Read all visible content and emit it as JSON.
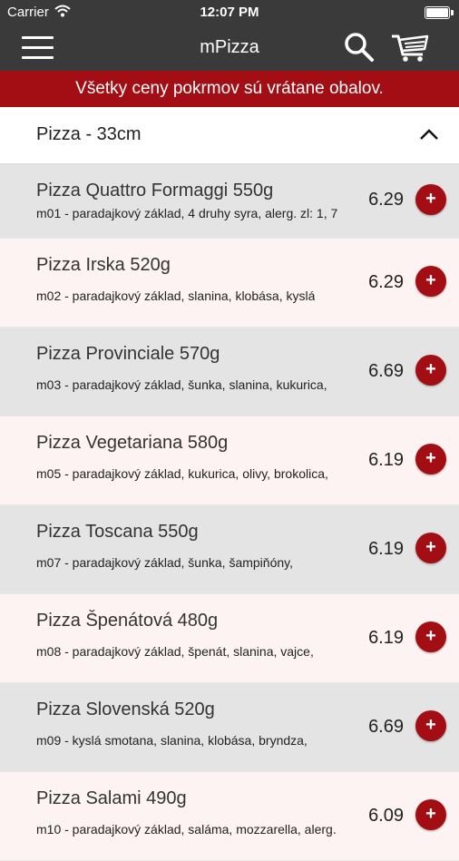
{
  "status": {
    "carrier": "Carrier",
    "time": "12:07 PM"
  },
  "navbar": {
    "title": "mPizza"
  },
  "banner": {
    "text": "Všetky ceny pokrmov sú vrátane obalov."
  },
  "section": {
    "title": "Pizza - 33cm"
  },
  "items": [
    {
      "name": "Pizza Quattro Formaggi 550g",
      "desc": "m01 - paradajkový základ, 4 druhy syra, alerg. zl: 1, 7",
      "price": "6.29"
    },
    {
      "name": "Pizza Irska 520g",
      "desc": "m02 - paradajkový základ, slanina, klobása, kyslá",
      "price": "6.29"
    },
    {
      "name": "Pizza Provinciale 570g",
      "desc": "m03 - paradajkový základ, šunka, slanina, kukurica,",
      "price": "6.69"
    },
    {
      "name": "Pizza Vegetariana 580g",
      "desc": "m05 - paradajkový základ, kukurica, olivy, brokolica,",
      "price": "6.19"
    },
    {
      "name": "Pizza Toscana 550g",
      "desc": "m07 - paradajkový základ, šunka, šampiňóny,",
      "price": "6.19"
    },
    {
      "name": "Pizza Špenátová 480g",
      "desc": "m08 - paradajkový základ, špenát, slanina, vajce,",
      "price": "6.19"
    },
    {
      "name": "Pizza Slovenská 520g",
      "desc": "m09 - kyslá smotana, slanina, klobása, bryndza,",
      "price": "6.69"
    },
    {
      "name": "Pizza Salami 490g",
      "desc": "m10 - paradajkový základ, saláma, mozzarella, alerg.",
      "price": "6.09"
    }
  ],
  "colors": {
    "accent": "#a20e14",
    "navbar": "#3a3a3a",
    "row_gray": "#e4e4e4",
    "row_pink": "#fdf3f2"
  }
}
